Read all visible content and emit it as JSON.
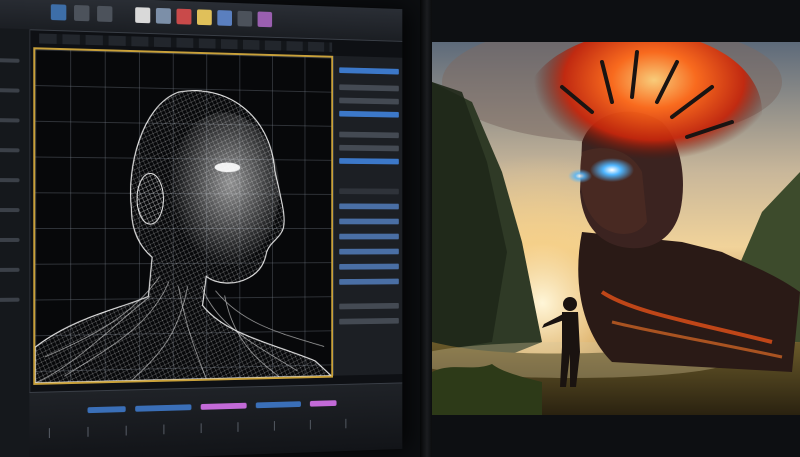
{
  "scene": {
    "left_panel": "3d-modeling-software-screen",
    "right_panel": "digital-artwork-fiery-robot-head"
  },
  "colors": {
    "viewport_border": "#c9a13a",
    "fire_orange": "#ff6a1a",
    "glow_blue": "#4fb6ff"
  }
}
